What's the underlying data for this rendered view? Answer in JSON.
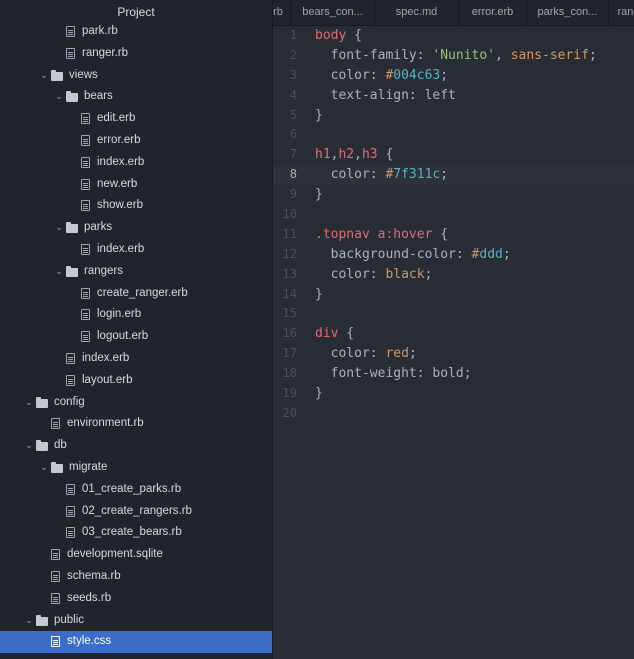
{
  "sidebar": {
    "title": "Project",
    "items": [
      {
        "label": "park.rb",
        "type": "file",
        "depth": 4
      },
      {
        "label": "ranger.rb",
        "type": "file",
        "depth": 4
      },
      {
        "label": "views",
        "type": "folder",
        "depth": 3,
        "expanded": true
      },
      {
        "label": "bears",
        "type": "folder",
        "depth": 4,
        "expanded": true
      },
      {
        "label": "edit.erb",
        "type": "file",
        "depth": 5
      },
      {
        "label": "error.erb",
        "type": "file",
        "depth": 5
      },
      {
        "label": "index.erb",
        "type": "file",
        "depth": 5
      },
      {
        "label": "new.erb",
        "type": "file",
        "depth": 5
      },
      {
        "label": "show.erb",
        "type": "file",
        "depth": 5
      },
      {
        "label": "parks",
        "type": "folder",
        "depth": 4,
        "expanded": true
      },
      {
        "label": "index.erb",
        "type": "file",
        "depth": 5
      },
      {
        "label": "rangers",
        "type": "folder",
        "depth": 4,
        "expanded": true
      },
      {
        "label": "create_ranger.erb",
        "type": "file",
        "depth": 5
      },
      {
        "label": "login.erb",
        "type": "file",
        "depth": 5
      },
      {
        "label": "logout.erb",
        "type": "file",
        "depth": 5
      },
      {
        "label": "index.erb",
        "type": "file",
        "depth": 4
      },
      {
        "label": "layout.erb",
        "type": "file",
        "depth": 4
      },
      {
        "label": "config",
        "type": "folder",
        "depth": 2,
        "expanded": true
      },
      {
        "label": "environment.rb",
        "type": "file",
        "depth": 3
      },
      {
        "label": "db",
        "type": "folder",
        "depth": 2,
        "expanded": true
      },
      {
        "label": "migrate",
        "type": "folder",
        "depth": 3,
        "expanded": true
      },
      {
        "label": "01_create_parks.rb",
        "type": "file",
        "depth": 4
      },
      {
        "label": "02_create_rangers.rb",
        "type": "file",
        "depth": 4
      },
      {
        "label": "03_create_bears.rb",
        "type": "file",
        "depth": 4
      },
      {
        "label": "development.sqlite",
        "type": "file",
        "depth": 3
      },
      {
        "label": "schema.rb",
        "type": "file",
        "depth": 3
      },
      {
        "label": "seeds.rb",
        "type": "file",
        "depth": 3
      },
      {
        "label": "public",
        "type": "folder",
        "depth": 2,
        "expanded": true
      },
      {
        "label": "style.css",
        "type": "file",
        "depth": 3,
        "selected": true
      }
    ]
  },
  "tabs": [
    {
      "label": "rb"
    },
    {
      "label": "bears_con..."
    },
    {
      "label": "spec.md"
    },
    {
      "label": "error.erb"
    },
    {
      "label": "parks_con..."
    },
    {
      "label": "rang"
    }
  ],
  "editor": {
    "cursor_line": 8,
    "lines": [
      [
        [
          "sel",
          "body"
        ],
        [
          "punc",
          " {"
        ]
      ],
      [
        [
          "prop",
          "  font-family: "
        ],
        [
          "str",
          "'Nunito'"
        ],
        [
          "punc",
          ", "
        ],
        [
          "kw",
          "sans-serif"
        ],
        [
          "punc",
          ";"
        ]
      ],
      [
        [
          "prop",
          "  color: "
        ],
        [
          "hash",
          "#"
        ],
        [
          "num",
          "004c63"
        ],
        [
          "punc",
          ";"
        ]
      ],
      [
        [
          "prop",
          "  text-align: left"
        ]
      ],
      [
        [
          "punc",
          "}"
        ]
      ],
      [],
      [
        [
          "sel",
          "h1"
        ],
        [
          "punc",
          ","
        ],
        [
          "sel",
          "h2"
        ],
        [
          "punc",
          ","
        ],
        [
          "sel",
          "h3"
        ],
        [
          "punc",
          " {"
        ]
      ],
      [
        [
          "prop",
          "  color: "
        ],
        [
          "hash",
          "#"
        ],
        [
          "num",
          "7f311c"
        ],
        [
          "punc",
          ";"
        ]
      ],
      [
        [
          "punc",
          "}"
        ]
      ],
      [],
      [
        [
          "sel",
          ".topnav a:hover"
        ],
        [
          "punc",
          " {"
        ]
      ],
      [
        [
          "prop",
          "  background-color: "
        ],
        [
          "hash",
          "#"
        ],
        [
          "num",
          "ddd"
        ],
        [
          "punc",
          ";"
        ]
      ],
      [
        [
          "prop",
          "  color: "
        ],
        [
          "kw",
          "black"
        ],
        [
          "punc",
          ";"
        ]
      ],
      [
        [
          "punc",
          "}"
        ]
      ],
      [],
      [
        [
          "sel",
          "div"
        ],
        [
          "punc",
          " {"
        ]
      ],
      [
        [
          "prop",
          "  color: "
        ],
        [
          "kw",
          "red"
        ],
        [
          "punc",
          ";"
        ]
      ],
      [
        [
          "prop",
          "  font-weight: bold;"
        ]
      ],
      [
        [
          "punc",
          "}"
        ]
      ],
      []
    ]
  },
  "icons": {
    "folder": "folder-icon",
    "file": "file-icon",
    "expanded": "chevron-down-icon"
  },
  "colors": {
    "selection": "#3b6cc7",
    "background": "#282c34",
    "sidebar": "#21252b"
  }
}
